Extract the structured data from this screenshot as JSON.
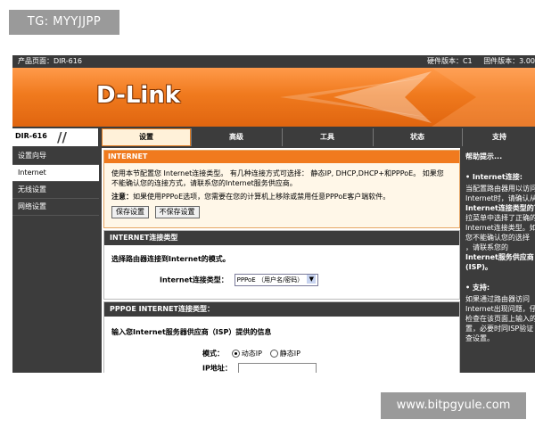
{
  "watermark": {
    "top": "TG: MYYJJPP",
    "bottom": "www.bitpgyule.com"
  },
  "topbar": {
    "product": "产品页面：DIR-616",
    "hardware": "硬件版本：C1",
    "firmware": "固件版本：3.00"
  },
  "banner": {
    "logo": "D-Link"
  },
  "model": "DIR-616",
  "tabs": [
    {
      "label": "设置"
    },
    {
      "label": "高级"
    },
    {
      "label": "工具"
    },
    {
      "label": "状态"
    },
    {
      "label": "支持"
    }
  ],
  "sidebar": {
    "items": [
      {
        "label": "设置向导"
      },
      {
        "label": "Internet"
      },
      {
        "label": "无线设置"
      },
      {
        "label": "网络设置"
      }
    ]
  },
  "intro": {
    "title": "INTERNET",
    "description": "使用本节配置您 Internet连接类型。 有几种连接方式可选择： 静态IP, DHCP,DHCP+和PPPoE。 如果您不能确认您的连接方式，请联系您的Internet服务供应商。",
    "note_label": "注意：",
    "note_text": "如果使用PPPoE选项，您需要在您的计算机上移除或禁用任意PPPoE客户端软件。",
    "save_label": "保存设置",
    "nosave_label": "不保存设置"
  },
  "conn_type": {
    "title": "INTERNET连接类型",
    "lead": "选择路由器连接到Internet的模式。",
    "field_label": "Internet连接类型：",
    "selected": "PPPoE （用户名/密码）"
  },
  "pppoe": {
    "title": "PPPOE INTERNET连接类型：",
    "lead": "输入您Internet服务器供应商（ISP）提供的信息",
    "mode_label": "模式：",
    "dynamic_label": "动态IP",
    "static_label": "静态IP",
    "ip_label": "IP地址："
  },
  "help": {
    "title": "帮助提示...",
    "bullet1": "• Internet连接:",
    "lines1": [
      "当配置路由器用以访问",
      "Internet时，请确认从",
      "Internet连接类型的下",
      "拉菜单中选择了正确的",
      "Internet连接类型。如",
      "您不能确认您的选择",
      "，请联系您的",
      "Internet服务供应商",
      "(ISP)。"
    ],
    "bullet2": "• 支持:",
    "lines2": [
      "如果通过路由器访问",
      "Internet出现问题，仔",
      "检查在该页面上输入的",
      "置，必要时同ISP验证",
      "查设置。"
    ]
  }
}
